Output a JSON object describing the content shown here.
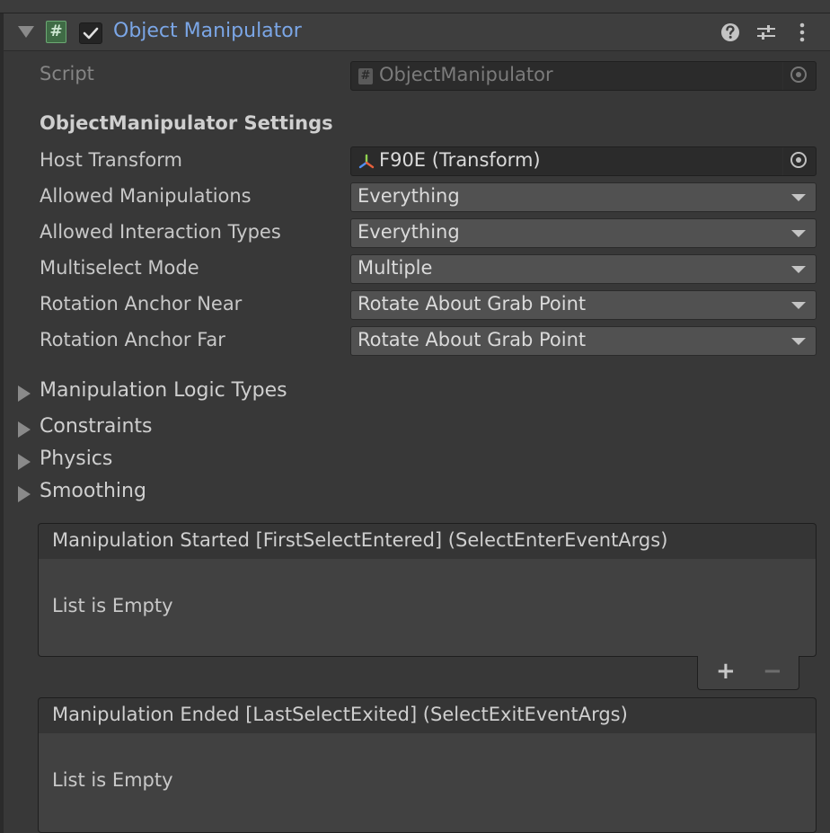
{
  "component": {
    "title": "Object Manipulator",
    "enabled": true,
    "script_icon_glyph": "#",
    "header_icons": [
      "help-icon",
      "preset-sliders-icon",
      "kebab-menu-icon"
    ]
  },
  "script_row": {
    "label": "Script",
    "value": "ObjectManipulator"
  },
  "settings": {
    "section_title": "ObjectManipulator Settings",
    "host_transform": {
      "label": "Host Transform",
      "value": "F90E (Transform)"
    },
    "allowed_manipulations": {
      "label": "Allowed Manipulations",
      "value": "Everything"
    },
    "allowed_interaction_types": {
      "label": "Allowed Interaction Types",
      "value": "Everything"
    },
    "multiselect_mode": {
      "label": "Multiselect Mode",
      "value": "Multiple"
    },
    "rotation_anchor_near": {
      "label": "Rotation Anchor Near",
      "value": "Rotate About Grab Point"
    },
    "rotation_anchor_far": {
      "label": "Rotation Anchor Far",
      "value": "Rotate About Grab Point"
    }
  },
  "foldouts": [
    {
      "label": "Manipulation Logic Types",
      "expanded": false
    },
    {
      "label": "Constraints",
      "expanded": false
    },
    {
      "label": "Physics",
      "expanded": false
    },
    {
      "label": "Smoothing",
      "expanded": false
    }
  ],
  "events": [
    {
      "title": "Manipulation Started [FirstSelectEntered] (SelectEnterEventArgs)",
      "empty_text": "List is Empty",
      "add_label": "+",
      "remove_label": "−"
    },
    {
      "title": "Manipulation Ended [LastSelectExited] (SelectExitEventArgs)",
      "empty_text": "List is Empty"
    }
  ],
  "colors": {
    "title_blue": "#7ba6e6",
    "panel_bg": "#383838",
    "field_bg": "#2b2b2b",
    "dropdown_bg": "#515151",
    "script_icon_green": "#3f6b45"
  }
}
